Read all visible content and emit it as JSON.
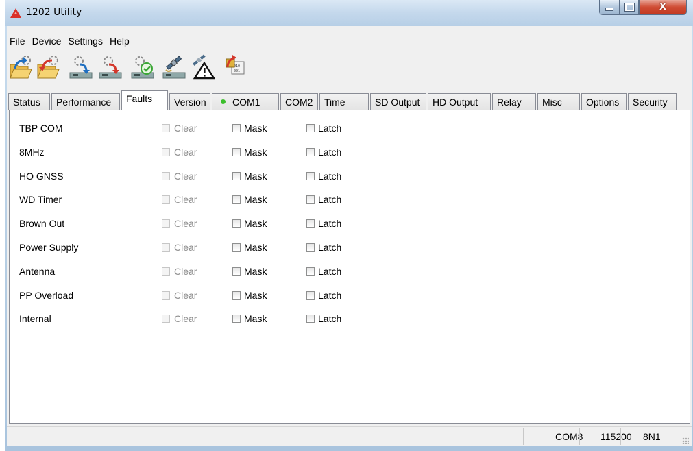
{
  "window": {
    "title": "1202 Utility",
    "controls": {
      "minimize": "▬",
      "maximize": "□",
      "close": "X"
    }
  },
  "menu": [
    "File",
    "Device",
    "Settings",
    "Help"
  ],
  "toolbar_icons": [
    "open-config-icon",
    "save-config-icon",
    "read-device-icon",
    "write-device-icon",
    "verify-device-icon",
    "gnss-satellite-icon",
    "gnss-warning-icon",
    "firmware-update-icon"
  ],
  "tabs": [
    {
      "label": "Status",
      "active": false
    },
    {
      "label": "Performance",
      "active": false
    },
    {
      "label": "Faults",
      "active": true
    },
    {
      "label": "Version",
      "active": false
    },
    {
      "label": "COM1",
      "active": false,
      "indicator": "#3cbf2c"
    },
    {
      "label": "COM2",
      "active": false
    },
    {
      "label": "Time",
      "active": false
    },
    {
      "label": "SD Output",
      "active": false
    },
    {
      "label": "HD Output",
      "active": false
    },
    {
      "label": "Relay",
      "active": false
    },
    {
      "label": "Misc",
      "active": false
    },
    {
      "label": "Options",
      "active": false
    },
    {
      "label": "Security",
      "active": false
    }
  ],
  "faults": {
    "clear_label": "Clear",
    "mask_label": "Mask",
    "latch_label": "Latch",
    "rows": [
      {
        "label": "TBP COM",
        "clear": false,
        "mask": false,
        "latch": false
      },
      {
        "label": "8MHz",
        "clear": false,
        "mask": false,
        "latch": false
      },
      {
        "label": "HO GNSS",
        "clear": false,
        "mask": false,
        "latch": false
      },
      {
        "label": "WD Timer",
        "clear": false,
        "mask": false,
        "latch": false
      },
      {
        "label": "Brown Out",
        "clear": false,
        "mask": false,
        "latch": false
      },
      {
        "label": "Power Supply",
        "clear": false,
        "mask": false,
        "latch": false
      },
      {
        "label": "Antenna",
        "clear": false,
        "mask": false,
        "latch": false
      },
      {
        "label": "PP Overload",
        "clear": false,
        "mask": false,
        "latch": false
      },
      {
        "label": "Internal",
        "clear": false,
        "mask": false,
        "latch": false
      }
    ]
  },
  "statusbar": {
    "port": "COM8",
    "baud": "115200",
    "format": "8N1"
  },
  "colors": {
    "accent_logo": "#d9312b",
    "com_indicator": "#3cbf2c"
  }
}
